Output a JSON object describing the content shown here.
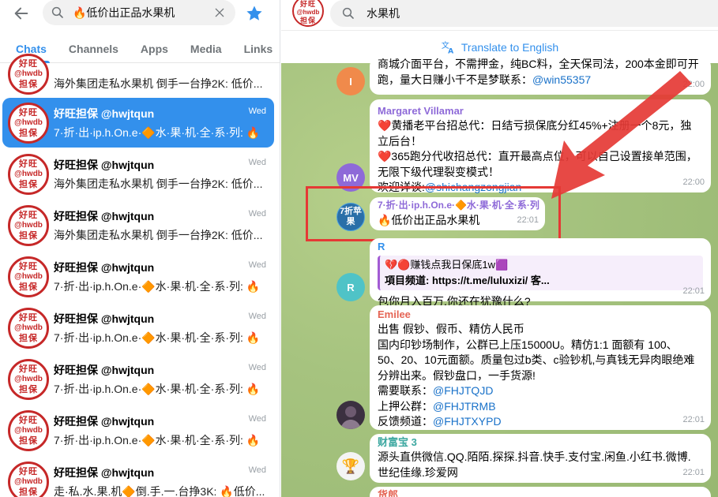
{
  "left_panel": {
    "search": {
      "query": "🔥低价出正品水果机"
    },
    "tabs": [
      {
        "label": "Chats"
      },
      {
        "label": "Channels"
      },
      {
        "label": "Apps"
      },
      {
        "label": "Media"
      },
      {
        "label": "Links"
      }
    ],
    "avatar_text": {
      "line1": "好旺",
      "line2": "@hwdb",
      "line3": "担保"
    },
    "chats": [
      {
        "name": "",
        "preview": "海外集团走私水果机 倒手一台挣2K: 低价...",
        "time": ""
      },
      {
        "name": "好旺担保 @hwjtqun",
        "preview": "7·折·出·ip.h.On.e·🔶水·果·机·全·系·列: 🔥",
        "time": "Wed"
      },
      {
        "name": "好旺担保 @hwjtqun",
        "preview": "海外集团走私水果机 倒手一台挣2K: 低价...",
        "time": "Wed"
      },
      {
        "name": "好旺担保 @hwjtqun",
        "preview": "海外集团走私水果机 倒手一台挣2K: 低价...",
        "time": "Wed"
      },
      {
        "name": "好旺担保 @hwjtqun",
        "preview": "7·折·出·ip.h.On.e·🔶水·果·机·全·系·列: 🔥",
        "time": "Wed"
      },
      {
        "name": "好旺担保 @hwjtqun",
        "preview": "7·折·出·ip.h.On.e·🔶水·果·机·全·系·列: 🔥",
        "time": "Wed"
      },
      {
        "name": "好旺担保 @hwjtqun",
        "preview": "7·折·出·ip.h.On.e·🔶水·果·机·全·系·列: 🔥",
        "time": "Wed"
      },
      {
        "name": "好旺担保 @hwjtqun",
        "preview": "7·折·出·ip.h.On.e·🔶水·果·机·全·系·列: 🔥",
        "time": "Wed"
      },
      {
        "name": "好旺担保 @hwjtqun",
        "preview": "走·私.水.果.机🔶倒.手.一.台挣3K: 🔥低价...",
        "time": "Wed"
      }
    ]
  },
  "right_panel": {
    "header_avatar_text": {
      "line1": "好旺",
      "line2": "@hwdb",
      "line3": "担保"
    },
    "search": {
      "query": "水果机"
    },
    "translate_label": "Translate to English",
    "messages": [
      {
        "avatar": "I",
        "avatar_color": "#f08a4b",
        "lines": [
          "商城介面平台，不需押金，纯BC料，全天保司法，200本金即可开",
          "跑，量大日赚小千不是梦联系："
        ],
        "link": "@win55357",
        "time": "22:00"
      },
      {
        "avatar": "MV",
        "avatar_color": "#8e6ad8",
        "sender": "Margaret Villamar",
        "sender_color": "#8e6ad8",
        "lines": [
          "❤️黄播老平台招总代：日结亏损保底分红45%+注册一个8元，独",
          "立后台！",
          "❤️365跑分代收招总代：直开最高点位，可以自己设置接单范围，",
          "无限下级代理裂变模式！",
          "欢迎详谈:"
        ],
        "link": "@shichangzongjian",
        "time": "22:00"
      },
      {
        "avatar": "7折苹果",
        "sender": "7·折·出·ip.h.On.e·🔶水·果·机·全·系·列",
        "sender_color": "#8e6ad8",
        "lines": [
          "🔥低价出正品水果机"
        ],
        "time": "22:01"
      },
      {
        "avatar": "R",
        "avatar_color": "#4fc3c7",
        "sender": "R",
        "sender_color": "#3390ec",
        "quote": "💔🔴赚钱点我日保底1w🟪",
        "quote_line2_prefix": "項目频道: ",
        "quote_line2": "https://t.me/luluxizi/ 客...",
        "lines": [
          "包你月入百万.你还在犹豫什么?"
        ],
        "time": "22:01"
      },
      {
        "avatar": "E",
        "sender": "Emilee",
        "sender_color": "#e56555",
        "lines": [
          "出售 假钞、假币、精仿人民币",
          "国内印钞场制作，公群已上压15000U。精仿1:1 面额有 100、",
          "50、20、10元面额。质量包过b类、c验钞机,与真钱无异肉眼绝难",
          "分辨出来。假钞盘口，一手货源!"
        ],
        "contacts": [
          {
            "label": "需要联系：",
            "value": "@FHJTQJD"
          },
          {
            "label": "上押公群：",
            "value": "@FHJTRMB"
          },
          {
            "label": "反馈频道：",
            "value": "@FHJTXYPD"
          }
        ],
        "time": "22:01"
      },
      {
        "avatar": "🏆",
        "sender": "财富宝 3",
        "sender_color": "#3ba7a0",
        "lines": [
          "源头直供微信.QQ.陌陌.探探.抖音.快手.支付宝.闲鱼.小红书.微博.",
          "世纪佳缘.珍爱网"
        ],
        "time": "22:01"
      },
      {
        "sender": "货郎",
        "sender_color": "#e56555"
      }
    ]
  },
  "colors": {
    "accent": "#3390ec",
    "highlight": "#e53935",
    "chat_bg": "#9dbb74"
  }
}
